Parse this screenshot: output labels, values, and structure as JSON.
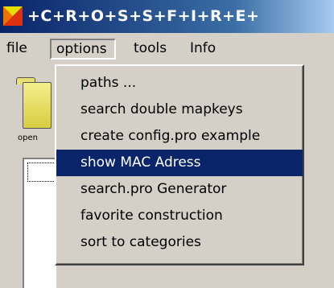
{
  "window": {
    "title": "+C+R+O+S+S+F+I+R+E+"
  },
  "menubar": {
    "items": [
      {
        "label": "file"
      },
      {
        "label": "options"
      },
      {
        "label": "tools"
      },
      {
        "label": "Info"
      }
    ]
  },
  "toolbar": {
    "open_label": "open"
  },
  "options_menu": {
    "items": [
      {
        "label": "paths ..."
      },
      {
        "label": "search double mapkeys"
      },
      {
        "label": "create config.pro example"
      },
      {
        "label": "show MAC Adress"
      },
      {
        "label": "search.pro Generator"
      },
      {
        "label": "favorite construction"
      },
      {
        "label": "sort to categories"
      }
    ],
    "highlighted": "show MAC Adress"
  },
  "colors": {
    "highlight": "#0a246a",
    "titlebar_start": "#0a246a",
    "face": "#d4d0c8"
  }
}
